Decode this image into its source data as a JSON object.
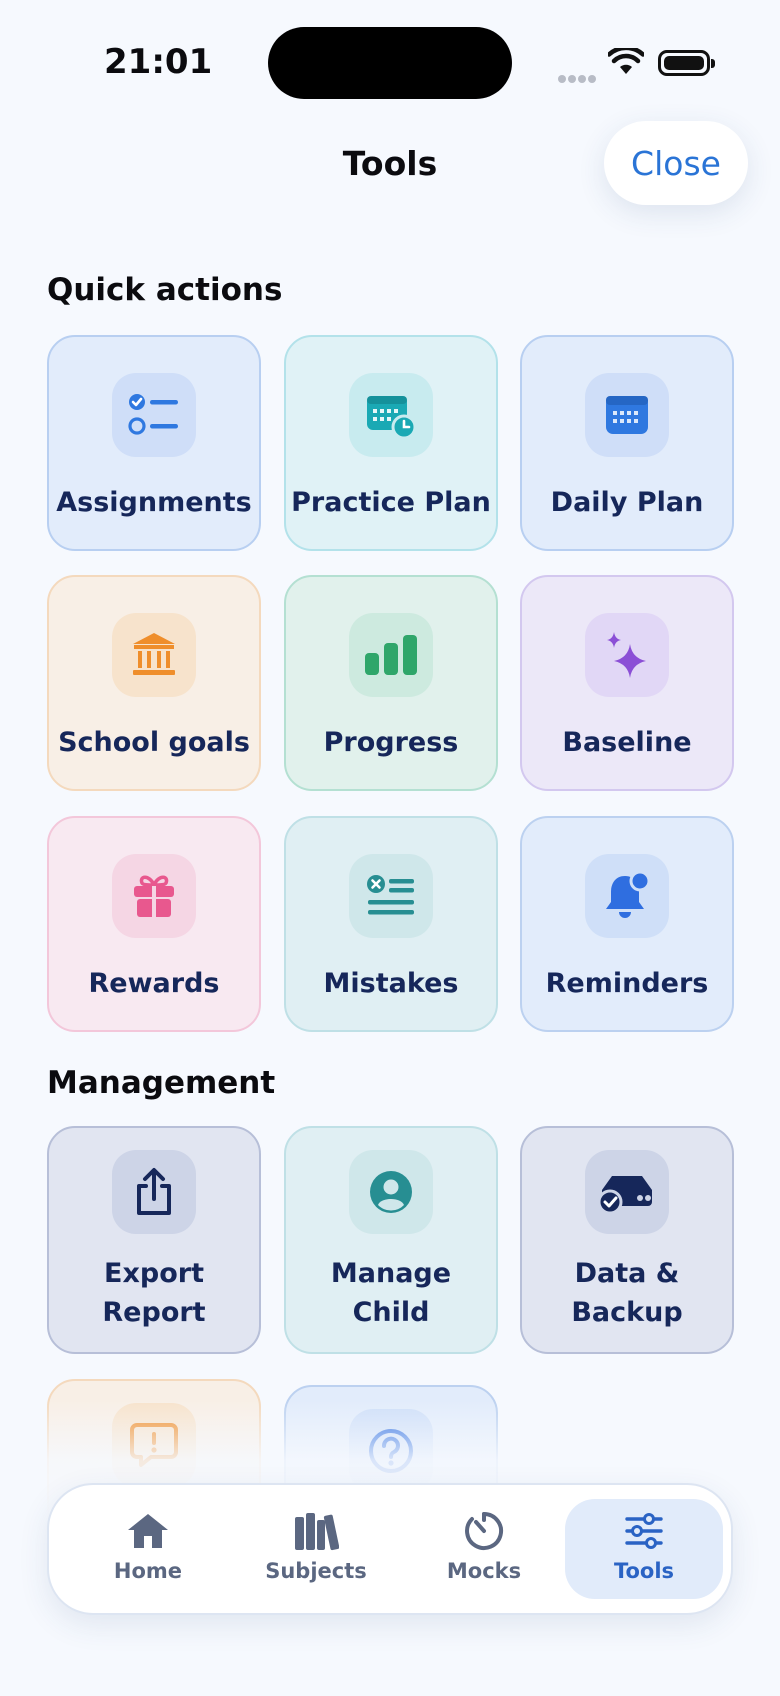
{
  "status": {
    "time": "21:01"
  },
  "header": {
    "title": "Tools",
    "close_label": "Close"
  },
  "sections": {
    "quick_actions": {
      "title": "Quick actions",
      "tiles": [
        {
          "label": "Assignments",
          "icon": "checklist-icon"
        },
        {
          "label": "Practice Plan",
          "icon": "calendar-clock-icon"
        },
        {
          "label": "Daily Plan",
          "icon": "calendar-icon"
        },
        {
          "label": "School goals",
          "icon": "building-columns-icon"
        },
        {
          "label": "Progress",
          "icon": "bar-chart-icon"
        },
        {
          "label": "Baseline",
          "icon": "sparkles-icon"
        },
        {
          "label": "Rewards",
          "icon": "gift-icon"
        },
        {
          "label": "Mistakes",
          "icon": "list-x-icon"
        },
        {
          "label": "Reminders",
          "icon": "bell-badge-icon"
        }
      ]
    },
    "management": {
      "title": "Management",
      "tiles": [
        {
          "label": "Export Report",
          "icon": "share-icon"
        },
        {
          "label": "Manage Child",
          "icon": "person-circle-icon"
        },
        {
          "label": "Data & Backup",
          "icon": "drive-check-icon"
        },
        {
          "label": "",
          "icon": "feedback-icon"
        },
        {
          "label": "",
          "icon": "help-icon"
        }
      ]
    }
  },
  "tabbar": {
    "items": [
      {
        "label": "Home",
        "icon": "house-icon"
      },
      {
        "label": "Subjects",
        "icon": "books-icon"
      },
      {
        "label": "Mocks",
        "icon": "timer-icon"
      },
      {
        "label": "Tools",
        "icon": "sliders-icon",
        "active": true
      }
    ]
  },
  "colors": {
    "accent": "#2a74d6",
    "tile_text": "#16275a",
    "background": "#f6f9fe"
  }
}
